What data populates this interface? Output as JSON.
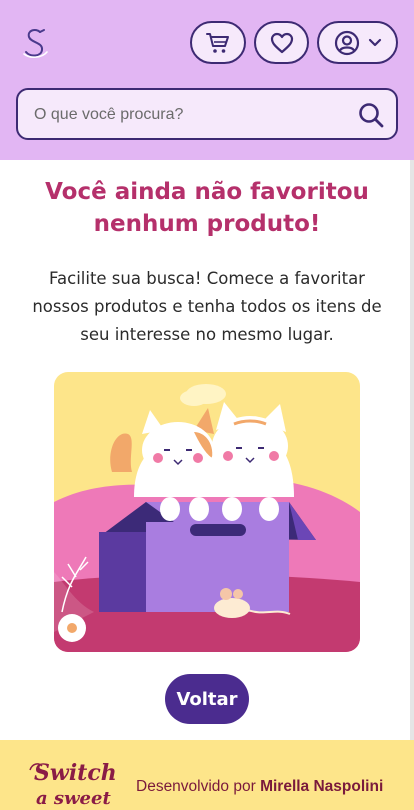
{
  "header": {
    "logo": {
      "icon": "swan-logo-icon"
    },
    "cart": {
      "icon": "shopping-cart-icon"
    },
    "favorites": {
      "icon": "heart-icon"
    },
    "account": {
      "icon": "user-circle-icon",
      "dropdown_icon": "chevron-down-icon"
    },
    "search": {
      "placeholder": "O que você procura?",
      "icon": "search-icon"
    }
  },
  "main": {
    "title": "Você ainda não favoritou nenhum produto!",
    "description": "Facilite sua busca! Comece a favoritar nossos produtos e tenha todos os itens de seu interesse no mesmo lugar.",
    "illustration": "cats-in-box-illustration",
    "back_button": "Voltar"
  },
  "footer": {
    "logo_text": "Switch a sweet",
    "credit_prefix": "Desenvolvido por",
    "credit_name": "Mirella Naspolini"
  },
  "colors": {
    "header_bg": "#e2b6f3",
    "primary": "#3d2a73",
    "title": "#b5306b",
    "button": "#4b2c8f",
    "footer_bg": "#fde58a",
    "footer_text": "#7a1a3c"
  }
}
